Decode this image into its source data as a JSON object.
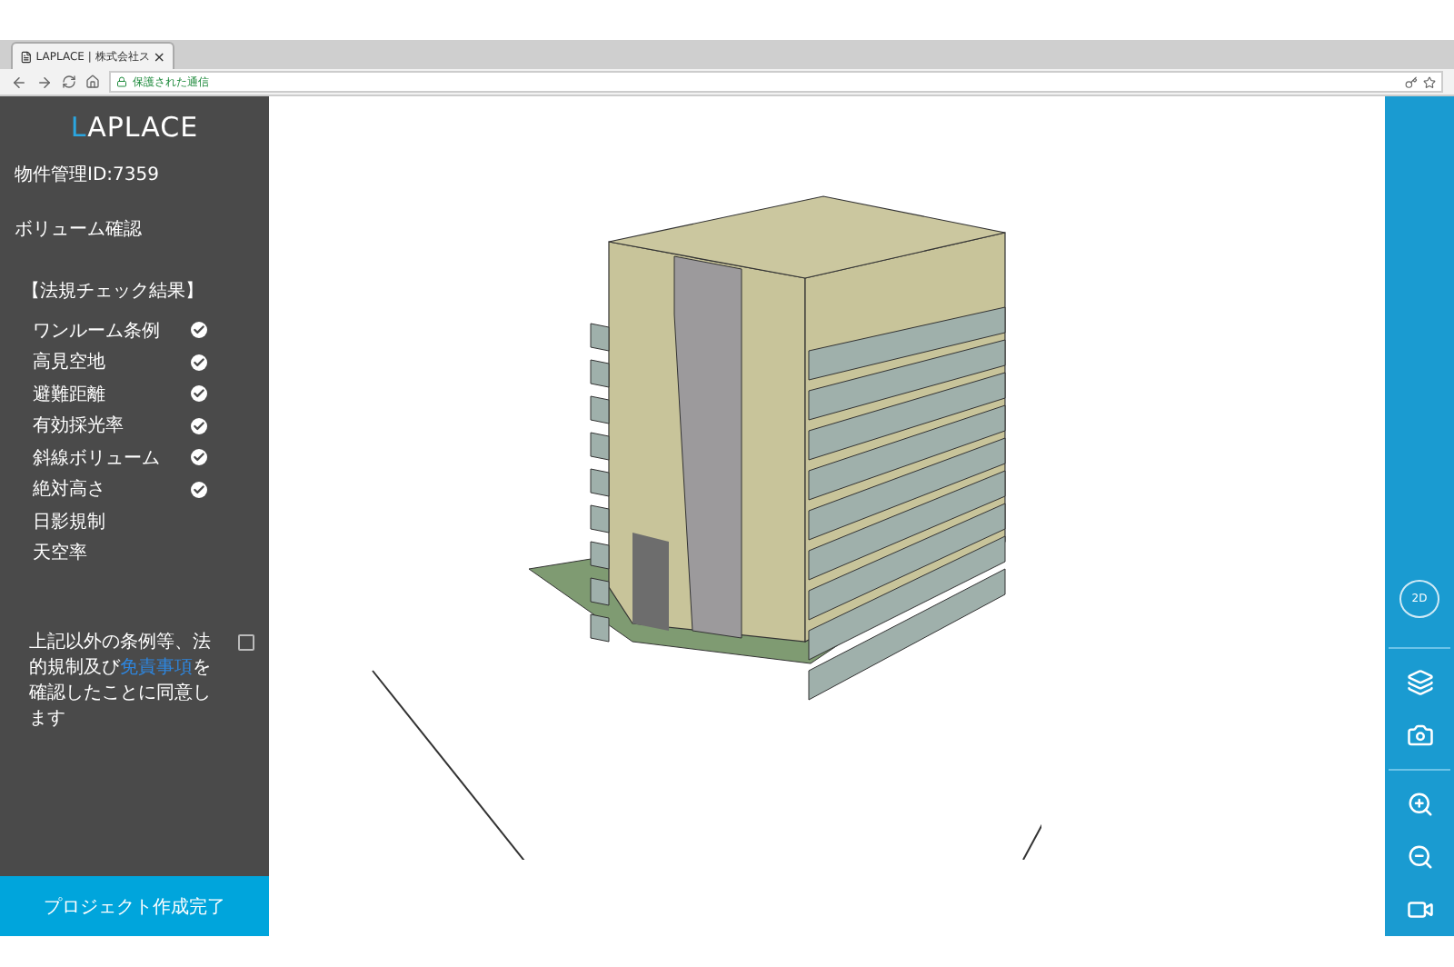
{
  "browser": {
    "tab_title": "LAPLACE | 株式会社ス",
    "close": "×",
    "security": "保護された通信"
  },
  "sidebar": {
    "logo_initial": "L",
    "logo_rest": "APLACE",
    "property_id": "物件管理ID:7359",
    "volume_check": "ボリューム確認",
    "checks_heading": "【法規チェック結果】",
    "checks": [
      {
        "label": "ワンルーム条例",
        "checked": true
      },
      {
        "label": "高見空地",
        "checked": true
      },
      {
        "label": "避難距離",
        "checked": true
      },
      {
        "label": "有効採光率",
        "checked": true
      },
      {
        "label": "斜線ボリューム",
        "checked": true
      },
      {
        "label": "絶対高さ",
        "checked": true
      },
      {
        "label": "日影規制",
        "checked": false
      },
      {
        "label": "天空率",
        "checked": false
      }
    ],
    "agreement": {
      "before": "上記以外の条例等、法的規制及び",
      "link": "免責事項",
      "after": "を確認したことに同意します",
      "checked": false
    },
    "complete_button": "プロジェクト作成完了"
  },
  "toolbar": {
    "view_toggle": "2D"
  }
}
